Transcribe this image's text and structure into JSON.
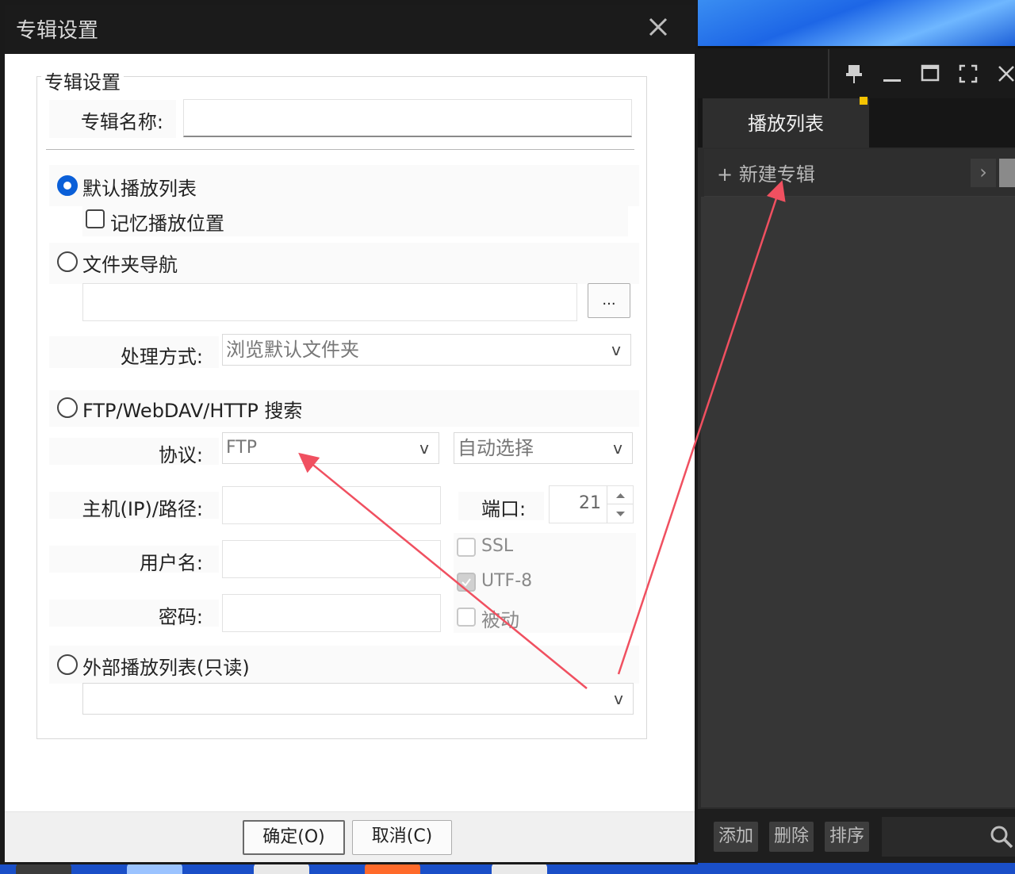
{
  "dialog": {
    "title": "专辑设置",
    "group_title": "专辑设置",
    "album_name_label": "专辑名称:",
    "album_name_value": "",
    "ok_label": "确定(O)",
    "cancel_label": "取消(C)"
  },
  "options": {
    "default_playlist": {
      "label": "默认播放列表",
      "selected": true
    },
    "remember_position": {
      "label": "记忆播放位置",
      "checked": false
    },
    "folder_nav": {
      "label": "文件夹导航",
      "selected": false,
      "path": "",
      "browse_label": "...",
      "process_label": "处理方式:",
      "process_value": "浏览默认文件夹"
    },
    "ftp": {
      "label": "FTP/WebDAV/HTTP 搜索",
      "selected": false,
      "protocol_label": "协议:",
      "protocol_value": "FTP",
      "encoding_value": "自动选择",
      "host_label": "主机(IP)/路径:",
      "port_label": "端口:",
      "port_value": "21",
      "user_label": "用户名:",
      "password_label": "密码:",
      "ssl_label": "SSL",
      "utf8_label": "UTF-8",
      "passive_label": "被动"
    },
    "external": {
      "label": "外部播放列表(只读)",
      "selected": false,
      "value": ""
    }
  },
  "caret": "v",
  "player": {
    "tab_label": "播放列表",
    "new_album_label": "+ 新建专辑",
    "add_label": "添加",
    "delete_label": "删除",
    "sort_label": "排序"
  },
  "colors": {
    "accent": "#0a5fd8",
    "annotation": "#f05060"
  },
  "icons": [
    "close-icon",
    "pin-icon",
    "minimize-icon",
    "maximize-icon",
    "fullscreen-icon",
    "search-icon",
    "chevron-right-icon",
    "spin-up-icon",
    "spin-down-icon",
    "dropdown-caret-icon"
  ]
}
